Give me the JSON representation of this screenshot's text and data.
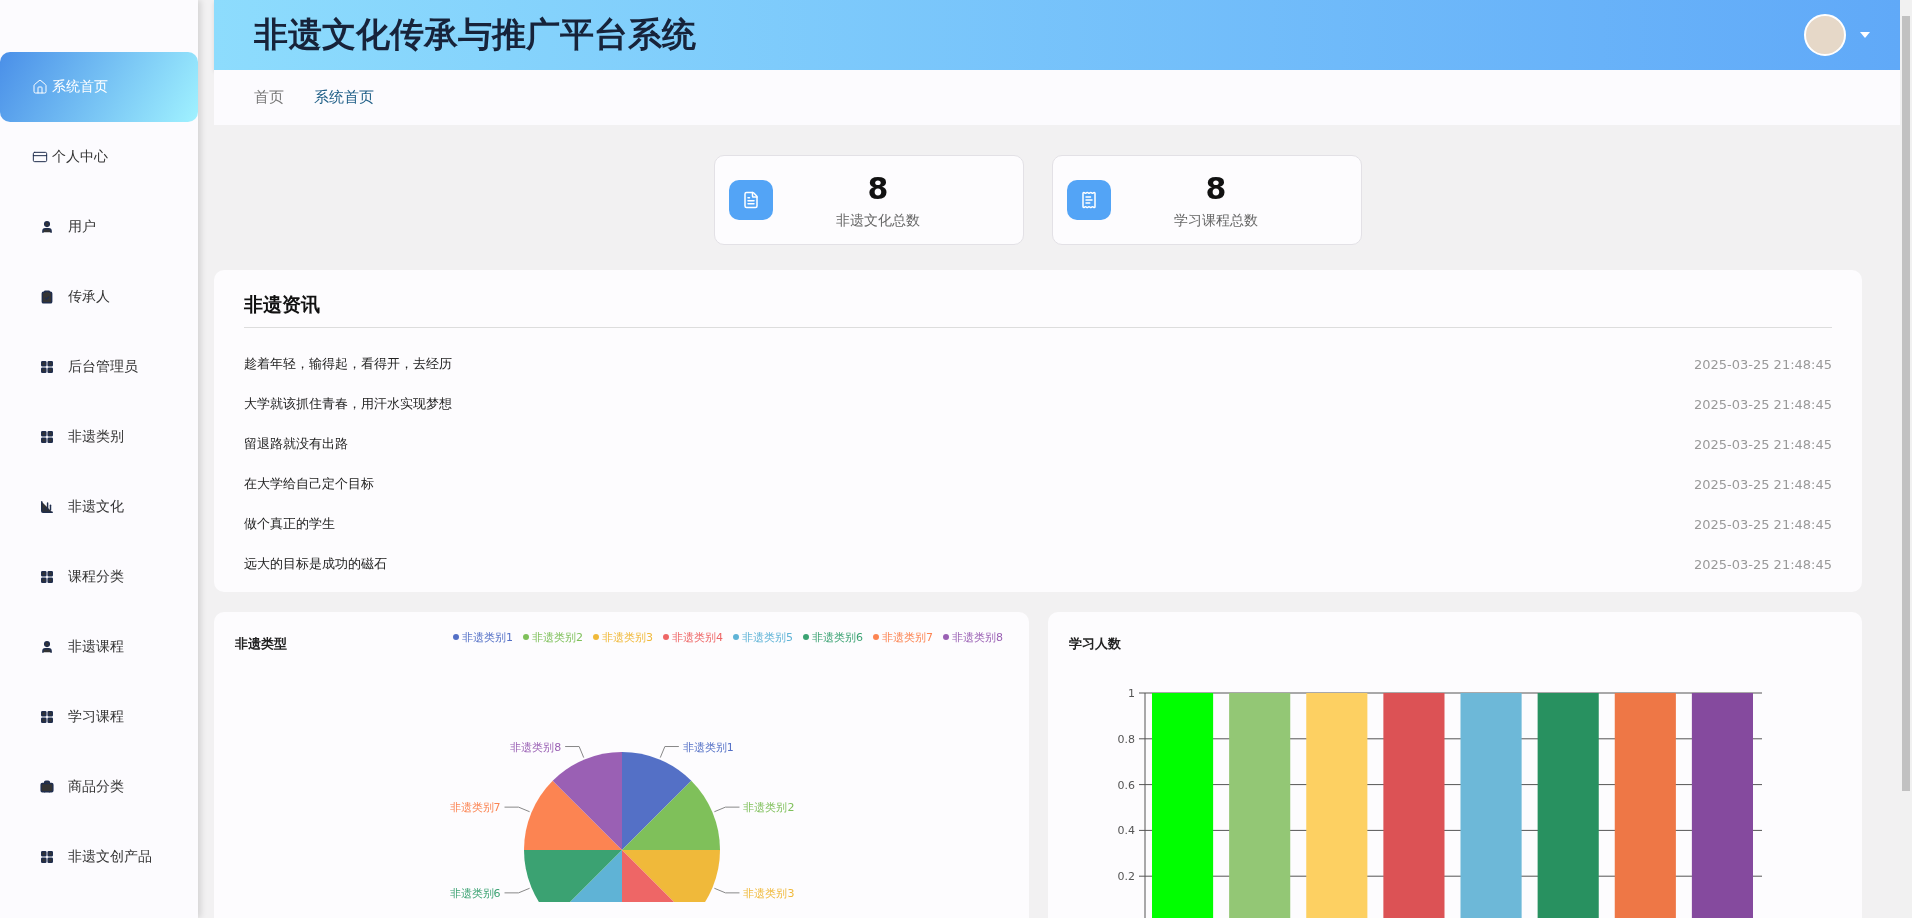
{
  "sidebar": {
    "items": [
      {
        "label": "系统首页",
        "kind": "page",
        "selected": true
      },
      {
        "label": "个人中心",
        "kind": "page",
        "selected": false
      },
      {
        "label": "用户",
        "kind": "table",
        "selected": false
      },
      {
        "label": "传承人",
        "kind": "table",
        "selected": false
      },
      {
        "label": "后台管理员",
        "kind": "table",
        "selected": false
      },
      {
        "label": "非遗类别",
        "kind": "table",
        "selected": false
      },
      {
        "label": "非遗文化",
        "kind": "table",
        "selected": false
      },
      {
        "label": "课程分类",
        "kind": "table",
        "selected": false
      },
      {
        "label": "非遗课程",
        "kind": "table",
        "selected": false
      },
      {
        "label": "学习课程",
        "kind": "table",
        "selected": false
      },
      {
        "label": "商品分类",
        "kind": "table",
        "selected": false
      },
      {
        "label": "非遗文创产品",
        "kind": "table",
        "selected": false
      }
    ]
  },
  "header": {
    "title": "非遗文化传承与推广平台系统"
  },
  "breadcrumb": [
    {
      "label": "首页",
      "selected": false
    },
    {
      "label": "系统首页",
      "selected": true
    }
  ],
  "stats": [
    {
      "value": "8",
      "label": "非遗文化总数"
    },
    {
      "value": "8",
      "label": "学习课程总数"
    }
  ],
  "news": {
    "title": "非遗资讯",
    "items": [
      {
        "text": "趁着年轻，输得起，看得开，去经历",
        "time": "2025-03-25 21:48:45"
      },
      {
        "text": "大学就该抓住青春，用汗水实现梦想",
        "time": "2025-03-25 21:48:45"
      },
      {
        "text": "留退路就没有出路",
        "time": "2025-03-25 21:48:45"
      },
      {
        "text": "在大学给自己定个目标",
        "time": "2025-03-25 21:48:45"
      },
      {
        "text": "做个真正的学生",
        "time": "2025-03-25 21:48:45"
      },
      {
        "text": "远大的目标是成功的磁石",
        "time": "2025-03-25 21:48:45"
      }
    ]
  },
  "pie_panel": {
    "chart_data": {
      "type": "pie",
      "title": "非遗类型",
      "legend": "top-right",
      "categories": [
        "非遗类别1",
        "非遗类别2",
        "非遗类别3",
        "非遗类别4",
        "非遗类别5",
        "非遗类别6",
        "非遗类别7",
        "非遗类别8"
      ],
      "values": [
        1,
        1,
        1,
        1,
        1,
        1,
        1,
        1
      ],
      "colors": [
        "#5470c6",
        "#7fc05a",
        "#f0b93a",
        "#ee6666",
        "#5fb3d6",
        "#3ba272",
        "#fc8452",
        "#9a60b4"
      ]
    }
  },
  "bar_panel": {
    "chart_data": {
      "type": "bar",
      "title": "学习人数",
      "ylim": [
        0,
        1
      ],
      "yticks": [
        0.2,
        0.4,
        0.6,
        0.8,
        1
      ],
      "grid": true,
      "values": [
        1,
        1,
        1,
        1,
        1,
        1,
        1,
        1
      ],
      "colors": [
        "#00ff00",
        "#93c775",
        "#fdd062",
        "#dc5255",
        "#6db8d8",
        "#289160",
        "#ee7746",
        "#854a9e"
      ]
    }
  }
}
